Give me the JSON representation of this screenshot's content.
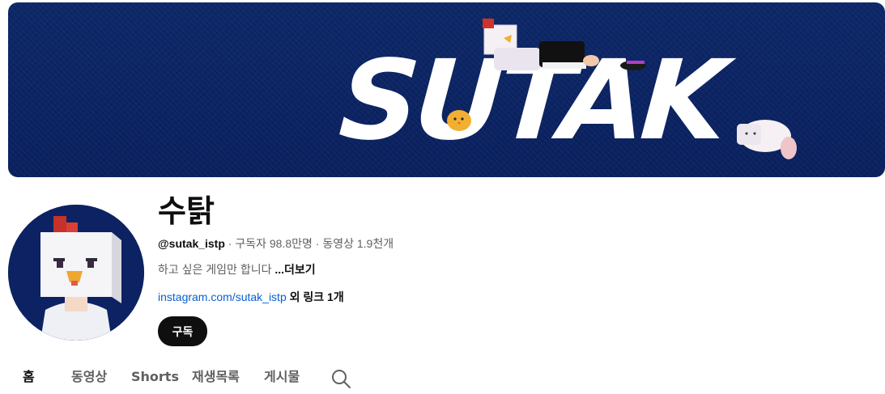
{
  "banner": {
    "title_text": "SUTAK",
    "background_color": "#0b2465"
  },
  "channel": {
    "name": "수탉",
    "handle": "@sutak_istp",
    "meta_rest": " · 구독자 98.8만명 · 동영상 1.9천개",
    "description": "하고 싶은 게임만 합니다 ",
    "more_label": "...더보기",
    "link_text": "instagram.com/sutak_istp",
    "extra_links": " 외 링크 1개",
    "subscribe_label": "구독",
    "avatar_icon": "chicken-avatar"
  },
  "tabs": [
    {
      "label": "홈",
      "active": true
    },
    {
      "label": "동영상",
      "active": false
    },
    {
      "label": "Shorts",
      "active": false
    },
    {
      "label": "재생목록",
      "active": false
    },
    {
      "label": "게시물",
      "active": false
    }
  ],
  "tab_search_icon": "search-icon",
  "colors": {
    "link": "#065fd4",
    "text_primary": "#0f0f0f",
    "text_secondary": "#606060"
  }
}
